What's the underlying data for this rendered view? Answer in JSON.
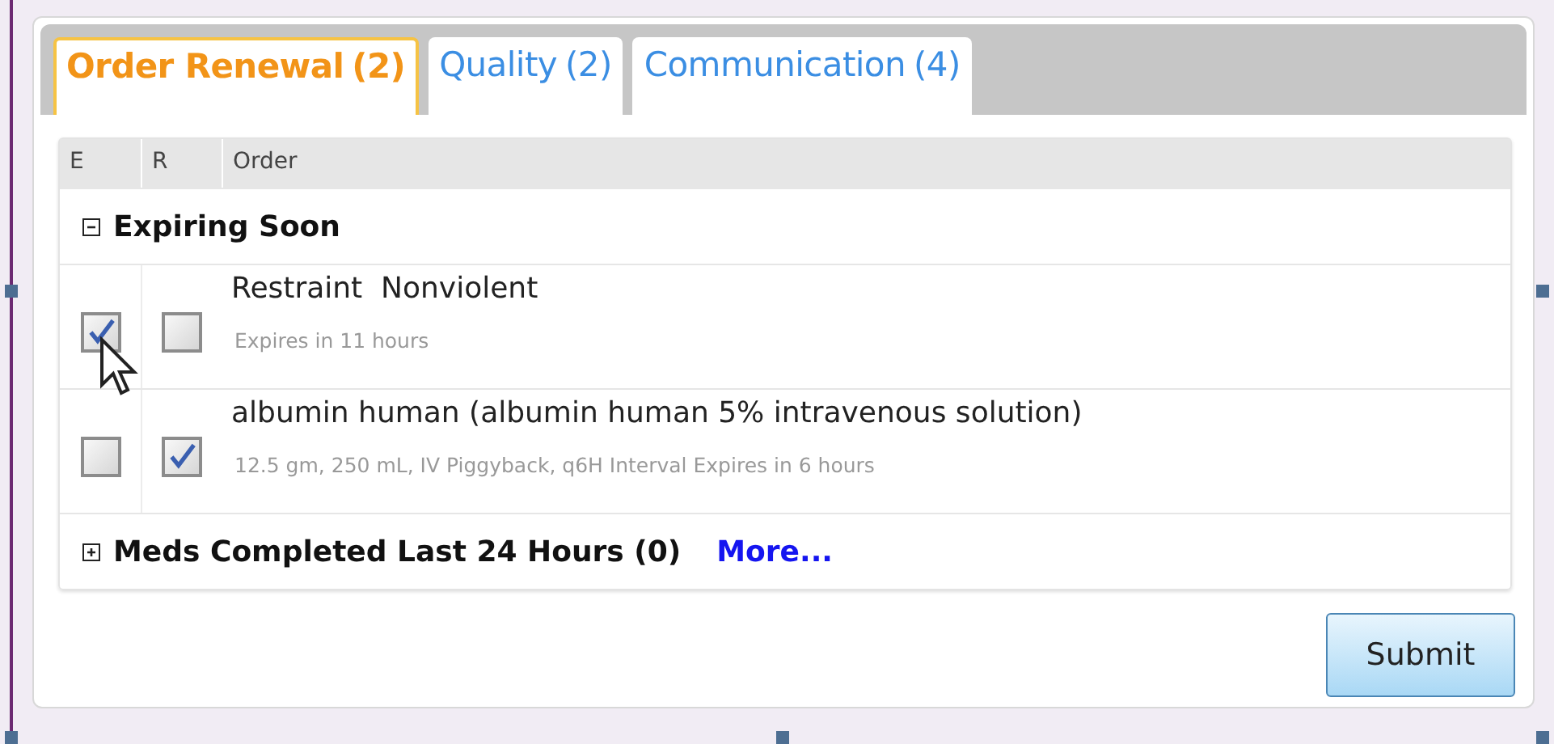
{
  "tabs": [
    {
      "label": "Order Renewal",
      "count": "(2)",
      "selected": true
    },
    {
      "label": "Quality",
      "count": "(2)",
      "selected": false
    },
    {
      "label": "Communication",
      "count": "(4)",
      "selected": false
    }
  ],
  "table": {
    "columns": [
      "E",
      "R",
      "Order"
    ],
    "groups": [
      {
        "title": "Expiring Soon",
        "expanded": true,
        "rows": [
          {
            "e_checked": true,
            "r_checked": false,
            "order": "Restraint  Nonviolent",
            "details": "Expires in 11 hours"
          },
          {
            "e_checked": false,
            "r_checked": true,
            "order": "albumin human (albumin human 5% intravenous solution)",
            "details": "12.5 gm, 250 mL, IV Piggyback, q6H Interval Expires in 6 hours"
          }
        ]
      },
      {
        "title": "Meds Completed Last 24 Hours (0)",
        "expanded": false,
        "link": "More..."
      }
    ]
  },
  "buttons": [
    "Submit"
  ]
}
